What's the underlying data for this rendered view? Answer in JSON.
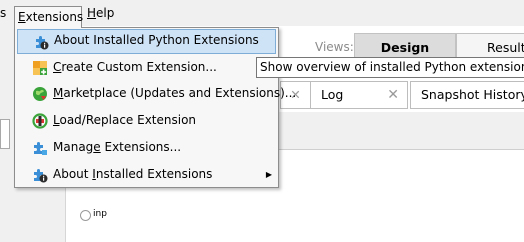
{
  "menubar": {
    "items": [
      {
        "label": "s"
      },
      {
        "label_underlined": "E",
        "label_rest": "xtensions"
      },
      {
        "label_underlined": "H",
        "label_rest": "elp"
      }
    ]
  },
  "views": {
    "label": "Views:",
    "tabs": [
      {
        "label": "Design"
      },
      {
        "label": "Results"
      }
    ]
  },
  "doc_tabs": [
    {
      "label": "",
      "close": "✕"
    },
    {
      "label": "Log",
      "close": "✕"
    },
    {
      "label": "Snapshot History"
    }
  ],
  "canvas": {
    "input_label": "inp"
  },
  "extensions_menu": {
    "items": [
      {
        "label": "About Installed Python Extensions",
        "icon": "python-info-icon",
        "highlighted": true
      },
      {
        "label_pre": "",
        "label_underlined": "C",
        "label_post": "reate Custom Extension...",
        "icon": "create-extension-icon"
      },
      {
        "label_pre": "",
        "label_underlined": "M",
        "label_post": "arketplace (Updates and Extensions)...",
        "icon": "marketplace-globe-icon"
      },
      {
        "label_pre": "",
        "label_underlined": "L",
        "label_post": "oad/Replace Extension",
        "icon": "load-replace-icon"
      },
      {
        "label_pre": "Manag",
        "label_underlined": "e",
        "label_post": " Extensions...",
        "icon": "manage-extensions-icon"
      },
      {
        "label_pre": "About ",
        "label_underlined": "I",
        "label_post": "nstalled Extensions",
        "icon": "extension-info-icon",
        "submenu": "▶"
      }
    ]
  },
  "tooltip": {
    "text": "Show overview of installed Python extensions"
  },
  "colors": {
    "highlight_bg": "#cfe3f7",
    "highlight_border": "#7eaed8",
    "puzzle_blue": "#3b8fd6",
    "create_orange": "#f0a020",
    "globe_green": "#3aa33a"
  }
}
